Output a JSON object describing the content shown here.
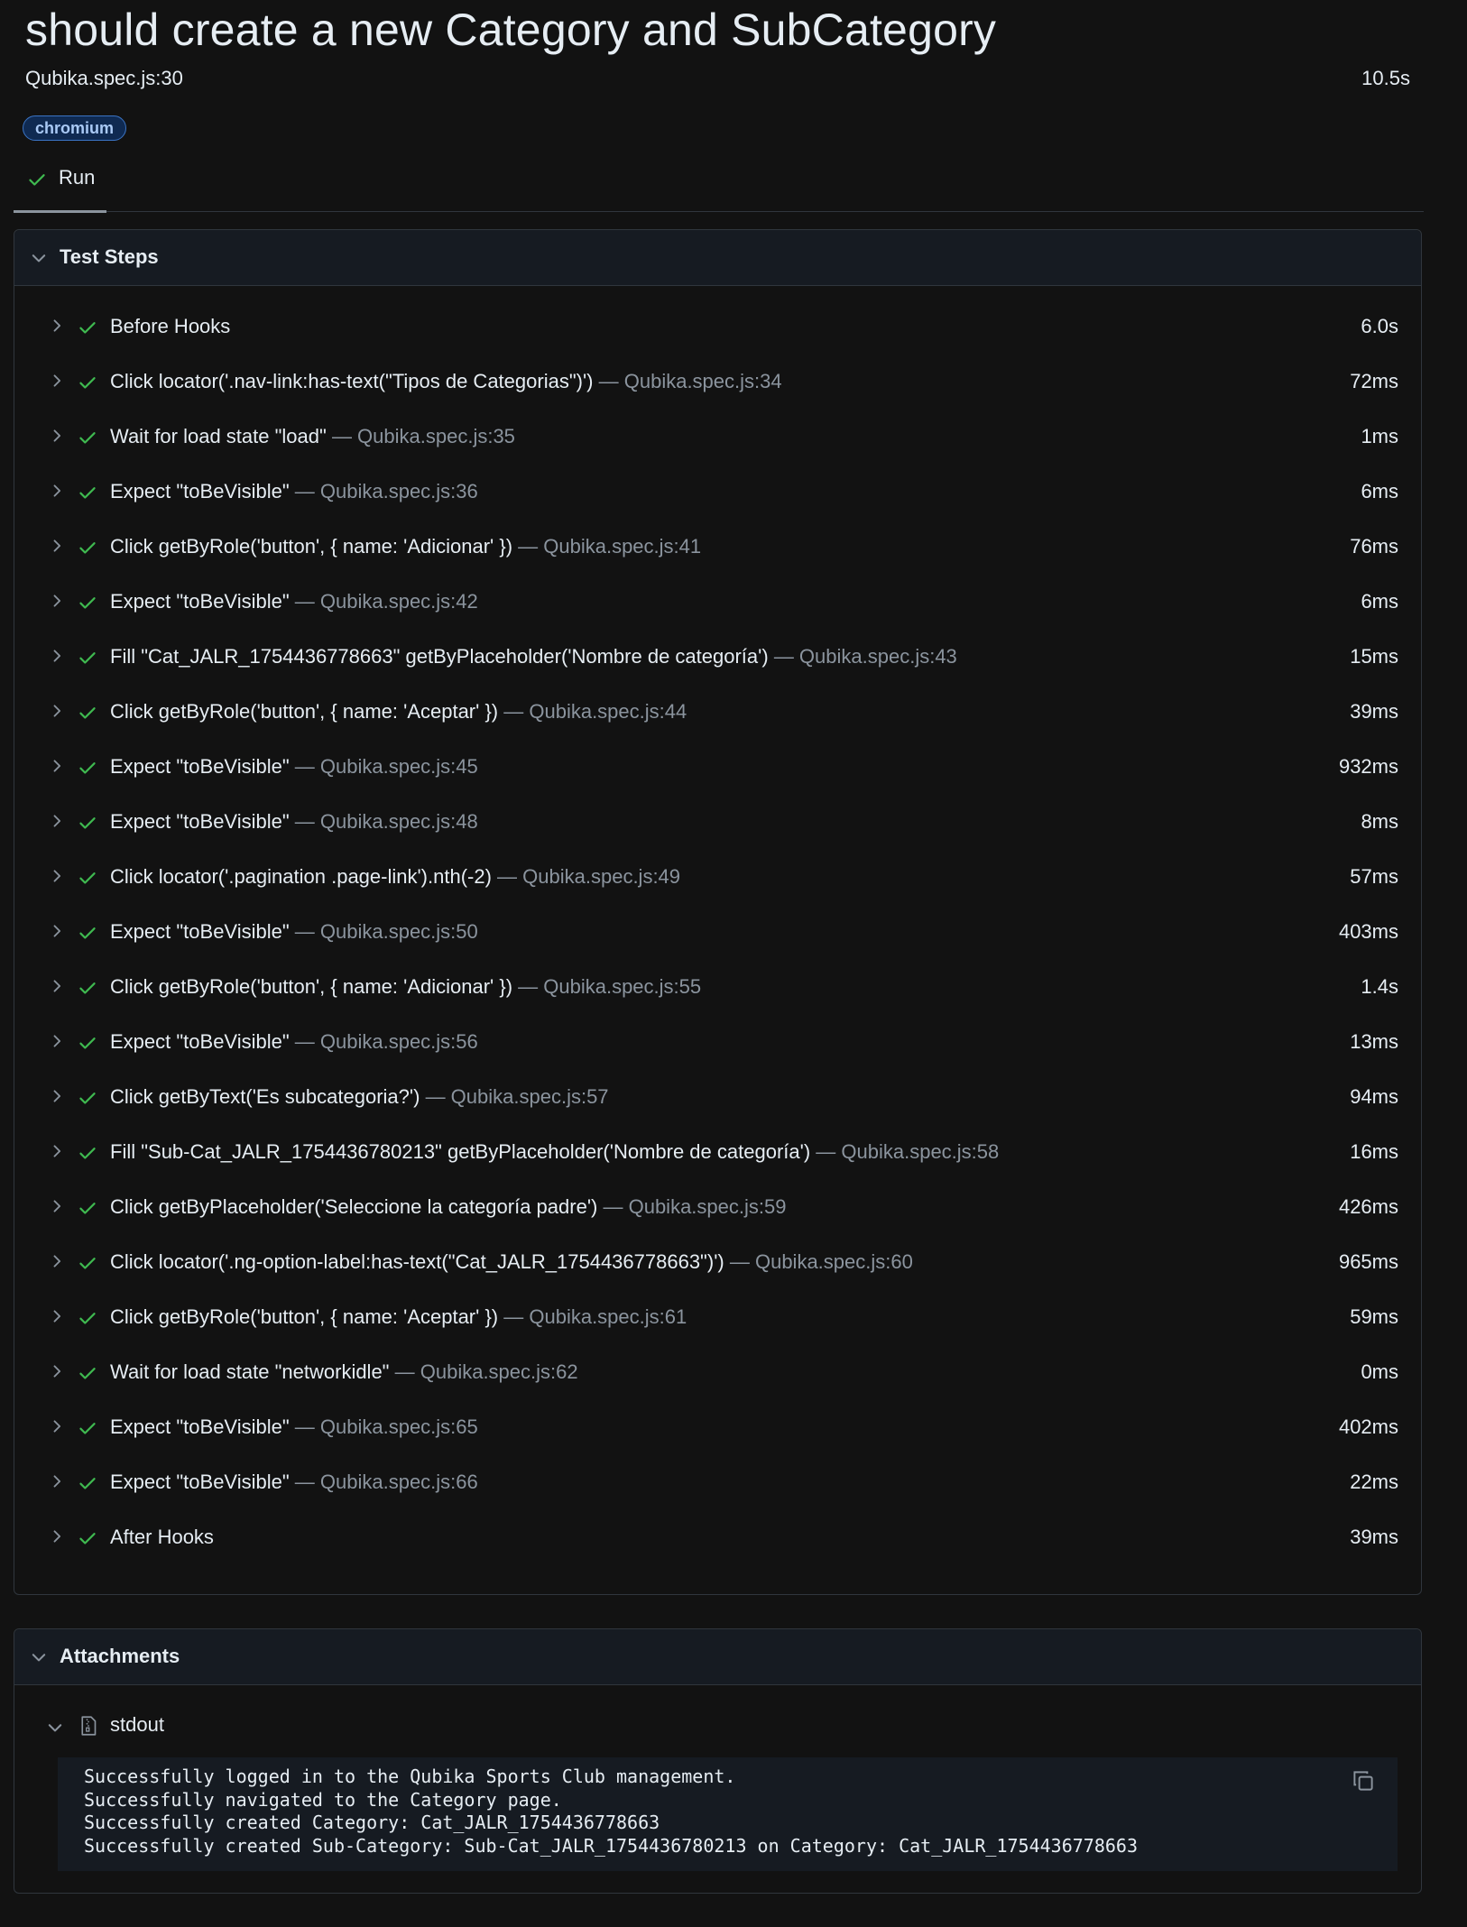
{
  "test": {
    "title": "should create a new Category and SubCategory",
    "location": "Qubika.spec.js:30",
    "duration": "10.5s",
    "project_tag": "chromium",
    "run_tab": "Run"
  },
  "colors": {
    "success": "#3fb950",
    "tag_bg": "#0f2a52",
    "tag_text": "#a9c9f5",
    "muted": "#8b949e"
  },
  "icons": {
    "expand": "chevron-right-icon",
    "collapse": "chevron-down-icon",
    "passed": "check-icon",
    "attachment": "file-zip-icon",
    "copy": "copy-icon"
  },
  "steps_section": {
    "title": "Test Steps",
    "steps": [
      {
        "text": "Before Hooks",
        "location": "",
        "duration": "6.0s"
      },
      {
        "text": "Click locator('.nav-link:has-text(\"Tipos de Categorias\")')",
        "location": "— Qubika.spec.js:34",
        "duration": "72ms"
      },
      {
        "text": "Wait for load state \"load\"",
        "location": "— Qubika.spec.js:35",
        "duration": "1ms"
      },
      {
        "text": "Expect \"toBeVisible\"",
        "location": "— Qubika.spec.js:36",
        "duration": "6ms"
      },
      {
        "text": "Click getByRole('button', { name: 'Adicionar' })",
        "location": "— Qubika.spec.js:41",
        "duration": "76ms"
      },
      {
        "text": "Expect \"toBeVisible\"",
        "location": "— Qubika.spec.js:42",
        "duration": "6ms"
      },
      {
        "text": "Fill \"Cat_JALR_1754436778663\" getByPlaceholder('Nombre de categoría')",
        "location": "— Qubika.spec.js:43",
        "duration": "15ms"
      },
      {
        "text": "Click getByRole('button', { name: 'Aceptar' })",
        "location": "— Qubika.spec.js:44",
        "duration": "39ms"
      },
      {
        "text": "Expect \"toBeVisible\"",
        "location": "— Qubika.spec.js:45",
        "duration": "932ms"
      },
      {
        "text": "Expect \"toBeVisible\"",
        "location": "— Qubika.spec.js:48",
        "duration": "8ms"
      },
      {
        "text": "Click locator('.pagination .page-link').nth(-2)",
        "location": "— Qubika.spec.js:49",
        "duration": "57ms"
      },
      {
        "text": "Expect \"toBeVisible\"",
        "location": "— Qubika.spec.js:50",
        "duration": "403ms"
      },
      {
        "text": "Click getByRole('button', { name: 'Adicionar' })",
        "location": "— Qubika.spec.js:55",
        "duration": "1.4s"
      },
      {
        "text": "Expect \"toBeVisible\"",
        "location": "— Qubika.spec.js:56",
        "duration": "13ms"
      },
      {
        "text": "Click getByText('Es subcategoria?')",
        "location": "— Qubika.spec.js:57",
        "duration": "94ms"
      },
      {
        "text": "Fill \"Sub-Cat_JALR_1754436780213\" getByPlaceholder('Nombre de categoría')",
        "location": "— Qubika.spec.js:58",
        "duration": "16ms"
      },
      {
        "text": "Click getByPlaceholder('Seleccione la categoría padre')",
        "location": "— Qubika.spec.js:59",
        "duration": "426ms"
      },
      {
        "text": "Click locator('.ng-option-label:has-text(\"Cat_JALR_1754436778663\")')",
        "location": "— Qubika.spec.js:60",
        "duration": "965ms"
      },
      {
        "text": "Click getByRole('button', { name: 'Aceptar' })",
        "location": "— Qubika.spec.js:61",
        "duration": "59ms"
      },
      {
        "text": "Wait for load state \"networkidle\"",
        "location": "— Qubika.spec.js:62",
        "duration": "0ms"
      },
      {
        "text": "Expect \"toBeVisible\"",
        "location": "— Qubika.spec.js:65",
        "duration": "402ms"
      },
      {
        "text": "Expect \"toBeVisible\"",
        "location": "— Qubika.spec.js:66",
        "duration": "22ms"
      },
      {
        "text": "After Hooks",
        "location": "",
        "duration": "39ms"
      }
    ]
  },
  "attachments_section": {
    "title": "Attachments",
    "attachment_name": "stdout",
    "stdout": "Successfully logged in to the Qubika Sports Club management.\nSuccessfully navigated to the Category page.\nSuccessfully created Category: Cat_JALR_1754436778663\nSuccessfully created Sub-Category: Sub-Cat_JALR_1754436780213 on Category: Cat_JALR_1754436778663"
  }
}
